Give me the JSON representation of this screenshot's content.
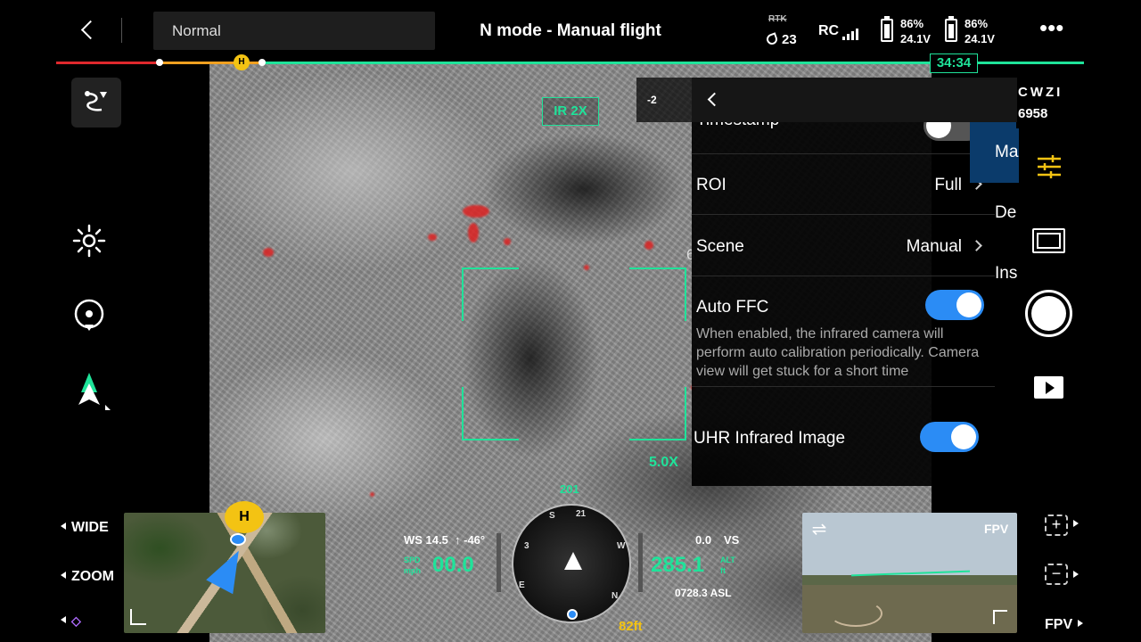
{
  "topbar": {
    "mode_dropdown": "Normal",
    "flight_mode": "N mode - Manual flight",
    "rtk_label": "RTK",
    "satellites": "23",
    "rc_label": "RC",
    "battery_1": {
      "percent": "86%",
      "voltage": "24.1V"
    },
    "battery_2": {
      "percent": "86%",
      "voltage": "24.1V"
    },
    "more_label": "•••"
  },
  "timeline": {
    "remaining": "34:34",
    "home_marker": "H",
    "progress": 0.06
  },
  "camera": {
    "ir_badge": "IR  2X",
    "zoom_readout": "5.0X",
    "exposure_hint": "-2",
    "label_6": "6"
  },
  "settings": {
    "timestamp_label": "Timestamp",
    "roi_label": "ROI",
    "roi_value": "Full",
    "scene_label": "Scene",
    "scene_value": "Manual",
    "auto_ffc_label": "Auto FFC",
    "auto_ffc_on": true,
    "auto_ffc_desc": "When enabled, the infrared camera will perform auto calibration periodically. Camera view will get stuck for a short time",
    "uhr_label": "UHR Infrared Image",
    "uhr_on": true
  },
  "side_tabs": [
    "Ma",
    "De",
    "Ins"
  ],
  "aircraft_id": {
    "line1": "CWZI",
    "line2": "6958"
  },
  "left_controls": {
    "wide_label": "WIDE",
    "zoom_label": "ZOOM"
  },
  "map": {
    "home_label": "H"
  },
  "telemetry": {
    "wind": "WS 14.5",
    "wind_dir": "↑ -46°",
    "speed_unit_top": "SPD",
    "speed_unit_bottom": "mph",
    "speed": "00.0",
    "heading": "201",
    "vs_value": "0.0",
    "vs_label": "VS",
    "altitude": "285.1",
    "alt_unit_top": "ALT",
    "alt_unit_bottom": "ft",
    "asl": "0728.3 ASL",
    "bottom_alt": "82ft",
    "compass_marks": [
      "S",
      "21",
      "W",
      "N",
      "E",
      "3"
    ]
  },
  "fpv": {
    "label": "FPV",
    "right_label": "FPV"
  },
  "right_zoom": {
    "plus": "+",
    "minus": "−"
  },
  "colors": {
    "accent_green": "#1fe39a",
    "toggle_blue": "#2b8cf5",
    "home_yellow": "#f3c313"
  }
}
